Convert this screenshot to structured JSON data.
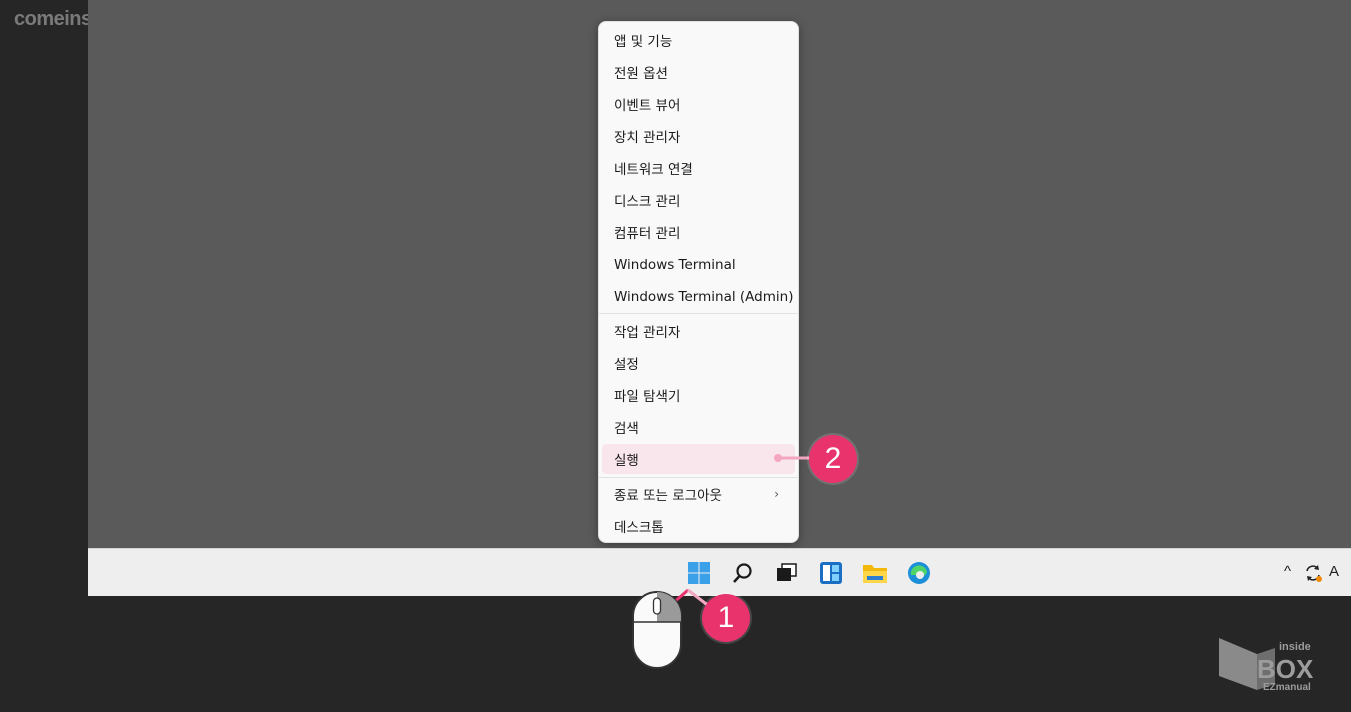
{
  "watermark": "comeinsidebox.com",
  "menu": {
    "group1": [
      "앱 및 기능",
      "전원 옵션",
      "이벤트 뷰어",
      "장치 관리자",
      "네트워크 연결",
      "디스크 관리",
      "컴퓨터 관리",
      "Windows Terminal",
      "Windows Terminal (Admin)"
    ],
    "group2": [
      "작업 관리자",
      "설정",
      "파일 탐색기",
      "검색",
      "실행"
    ],
    "group3": [
      "종료 또는 로그아웃",
      "데스크톱"
    ],
    "chevron": "›"
  },
  "badges": {
    "step1": "1",
    "step2": "2"
  },
  "taskbar": {
    "icons": [
      "windows-start-icon",
      "search-icon",
      "task-view-icon",
      "widgets-icon",
      "file-explorer-icon",
      "edge-icon"
    ],
    "tray": {
      "caret": "^",
      "input_indicator": "A"
    }
  },
  "logo": {
    "line1": "inside",
    "line2": "BOX",
    "line3": "EZmanual"
  },
  "colors": {
    "accent": "#e8336d",
    "highlight": "#f9e6ec",
    "desktop": "#5a5a5a",
    "taskbar": "#eeeeee"
  }
}
